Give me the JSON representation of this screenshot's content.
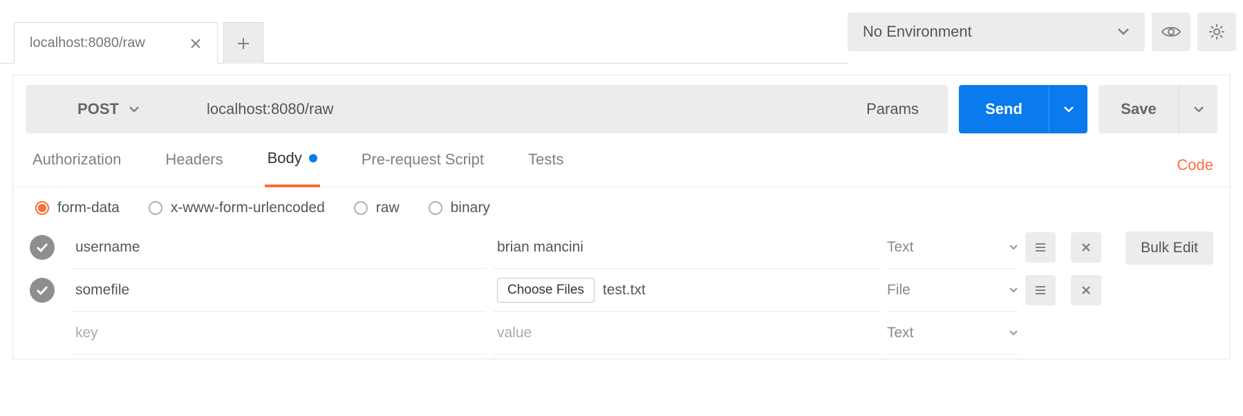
{
  "top": {
    "tab_title": "localhost:8080/raw",
    "env_label": "No Environment"
  },
  "request": {
    "method": "POST",
    "url": "localhost:8080/raw",
    "params_label": "Params",
    "send_label": "Send",
    "save_label": "Save"
  },
  "section_tabs": {
    "authorization": "Authorization",
    "headers": "Headers",
    "body": "Body",
    "prerequest": "Pre-request Script",
    "tests": "Tests",
    "code_link": "Code"
  },
  "body_types": {
    "form_data": "form-data",
    "urlencoded": "x-www-form-urlencoded",
    "raw": "raw",
    "binary": "binary"
  },
  "bulk_edit_label": "Bulk Edit",
  "form_data_rows": [
    {
      "key": "username",
      "value": "brian mancini",
      "type": "Text"
    },
    {
      "key": "somefile",
      "file_button": "Choose Files",
      "file_name": "test.txt",
      "type": "File"
    }
  ],
  "placeholders": {
    "key": "key",
    "value": "value",
    "type": "Text"
  },
  "icons": {
    "chevron": "chevron-down-icon",
    "check": "check-icon"
  }
}
